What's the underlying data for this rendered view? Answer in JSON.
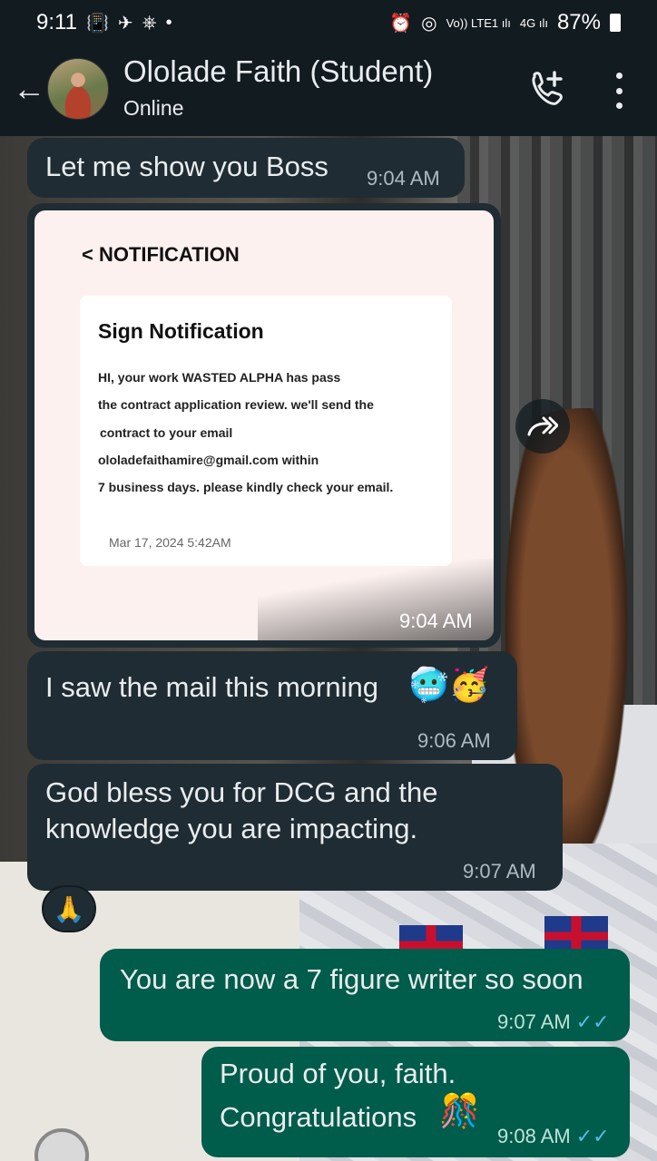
{
  "status_bar": {
    "time": "9:11",
    "left_icons": [
      "📳",
      "✈",
      "⎈",
      "•"
    ],
    "right_icons": [
      "⏰",
      "◎",
      "Vo)) LTE1 ılı",
      "4G ılı"
    ],
    "battery": "87%"
  },
  "header": {
    "back_icon": "←",
    "contact_name": "Ololade Faith (Student)",
    "status": "Online"
  },
  "messages": [
    {
      "text": "Let me show you Boss",
      "time": "9:04 AM"
    },
    {
      "type": "image",
      "time": "9:04 AM",
      "image": {
        "heading": "< NOTIFICATION",
        "card_title": "Sign Notification",
        "lines": [
          "HI, your work WASTED ALPHA has pass",
          "the contract application review. we'll send the",
          "contract to your email",
          "ololadefaithamire@gmail.com within",
          "7 business days. please kindly check your email."
        ],
        "date": "Mar 17, 2024 5:42AM"
      }
    },
    {
      "text": "I saw the mail this morning",
      "emoji": "🥶🥳",
      "time": "9:06 AM"
    },
    {
      "line1": "God bless you for DCG and the",
      "line2": "knowledge you are impacting.",
      "time": "9:07 AM",
      "reaction": "🙏"
    },
    {
      "text": "You are now a 7 figure writer so soon",
      "time": "9:07 AM",
      "ticks": "✓✓"
    },
    {
      "line1": "Proud of you, faith.",
      "line2": "Congratulations",
      "emoji": "🎊",
      "time": "9:08 AM",
      "ticks": "✓✓"
    }
  ],
  "colors": {
    "incoming_bubble": "#202c33",
    "outgoing_bubble": "#005c4b",
    "header_bg": "#121b20",
    "read_ticks": "#53bdeb"
  }
}
